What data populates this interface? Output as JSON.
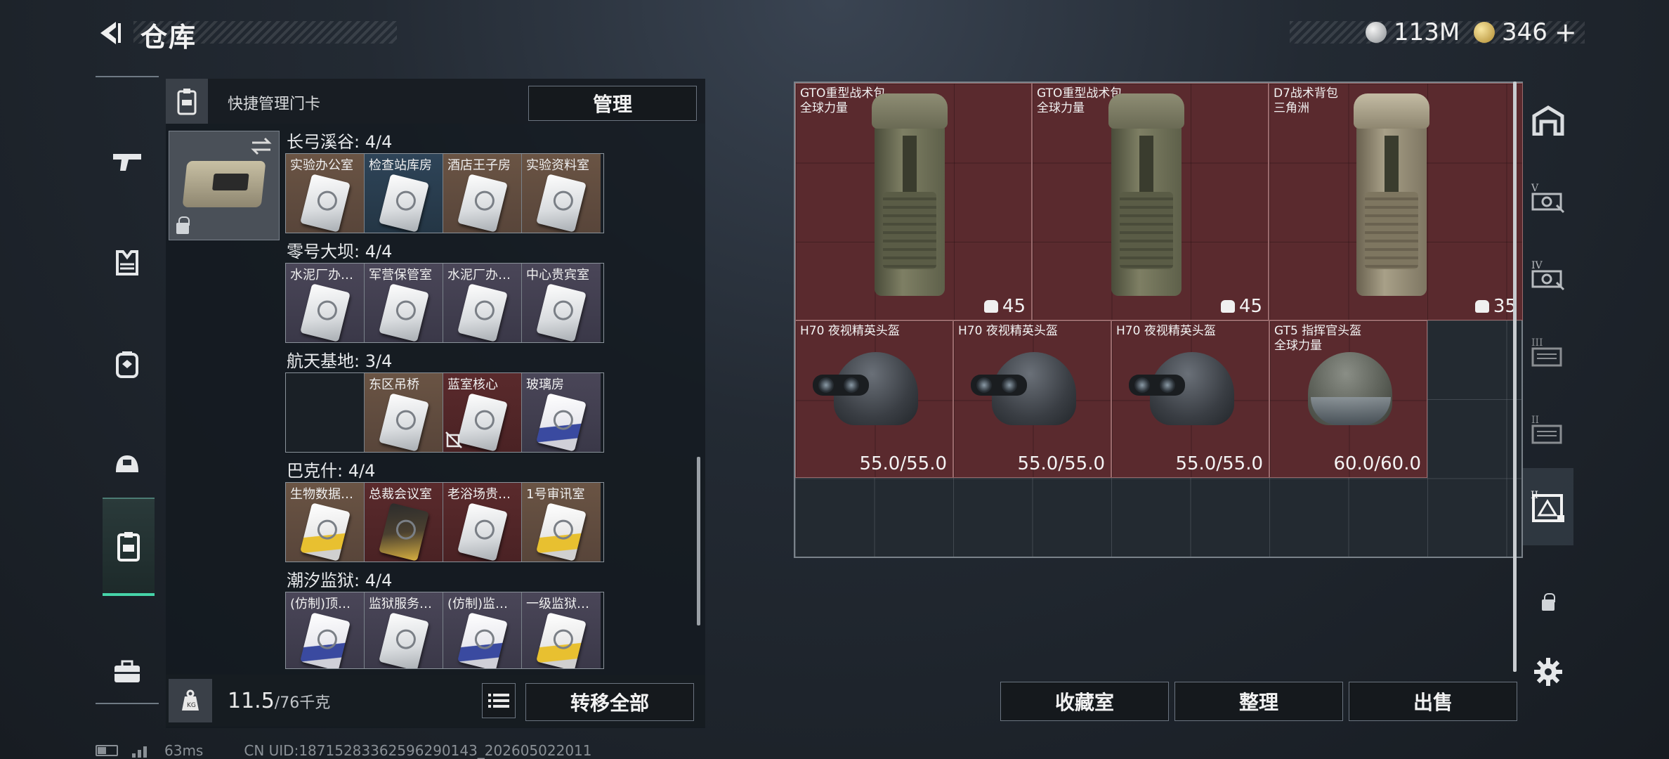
{
  "header": {
    "title": "仓库",
    "currency_silver": "113M",
    "currency_gold": "346",
    "add_label": "+"
  },
  "left_nav": [
    "weapons",
    "armor-vest",
    "backpack",
    "helmet",
    "keycard",
    "briefcase"
  ],
  "key_panel": {
    "header_label": "快捷管理门卡",
    "manage_label": "管理",
    "regions": [
      {
        "title": "长弓溪谷: 4/4",
        "cards": [
          {
            "name": "实验办公室",
            "rarity": "brown"
          },
          {
            "name": "检查站库房",
            "rarity": "blue"
          },
          {
            "name": "酒店王子房",
            "rarity": "brown"
          },
          {
            "name": "实验资料室",
            "rarity": "brown"
          }
        ]
      },
      {
        "title": "零号大坝: 4/4",
        "cards": [
          {
            "name": "水泥厂办…",
            "rarity": "purple"
          },
          {
            "name": "军营保管室",
            "rarity": "purple"
          },
          {
            "name": "水泥厂办…",
            "rarity": "purple"
          },
          {
            "name": "中心贵宾室",
            "rarity": "purple"
          }
        ]
      },
      {
        "title": "航天基地: 3/4",
        "cards": [
          {
            "name": "",
            "rarity": "empty"
          },
          {
            "name": "东区吊桥",
            "rarity": "brown"
          },
          {
            "name": "蓝室核心",
            "rarity": "red"
          },
          {
            "name": "玻璃房",
            "rarity": "purple"
          }
        ]
      },
      {
        "title": "巴克什: 4/4",
        "cards": [
          {
            "name": "生物数据…",
            "rarity": "brown"
          },
          {
            "name": "总裁会议室",
            "rarity": "red"
          },
          {
            "name": "老浴场贵…",
            "rarity": "red"
          },
          {
            "name": "1号审讯室",
            "rarity": "brown"
          }
        ]
      },
      {
        "title": "潮汐监狱: 4/4",
        "cards": [
          {
            "name": "(仿制)顶…",
            "rarity": "purple"
          },
          {
            "name": "监狱服务…",
            "rarity": "purple"
          },
          {
            "name": "(仿制)监…",
            "rarity": "purple"
          },
          {
            "name": "一级监狱…",
            "rarity": "purple"
          }
        ]
      }
    ],
    "weight_current": "11.5",
    "weight_max": "/76千克",
    "transfer_all_label": "转移全部"
  },
  "stash": {
    "items": [
      {
        "name": "GTO重型战术包",
        "subtitle": "全球力量",
        "stat": "45",
        "kind": "backpack"
      },
      {
        "name": "GTO重型战术包",
        "subtitle": "全球力量",
        "stat": "45",
        "kind": "backpack"
      },
      {
        "name": "D7战术背包",
        "subtitle": "三角洲",
        "stat": "35",
        "kind": "backpack-tan"
      },
      {
        "name": "H70 夜视精英头盔",
        "subtitle": "",
        "stat": "55.0/55.0",
        "kind": "helmet-nvg"
      },
      {
        "name": "H70 夜视精英头盔",
        "subtitle": "",
        "stat": "55.0/55.0",
        "kind": "helmet-nvg"
      },
      {
        "name": "H70 夜视精英头盔",
        "subtitle": "",
        "stat": "55.0/55.0",
        "kind": "helmet-nvg"
      },
      {
        "name": "GT5 指挥官头盔",
        "subtitle": "全球力量",
        "stat": "60.0/60.0",
        "kind": "helmet-commander"
      }
    ]
  },
  "right_nav": [
    "main-stash",
    "tier-v",
    "tier-iv",
    "tier-iii",
    "tier-ii",
    "tier-i-active",
    "locked"
  ],
  "actions": {
    "collection_label": "收藏室",
    "sort_label": "整理",
    "sell_label": "出售"
  },
  "status": {
    "ping": "63ms",
    "uid": "CN UID:18715283362596290143_202605022011"
  },
  "colors": {
    "accent_green": "#46d3a8",
    "item_red": "#5a2a2e",
    "rarity_brown": "#6a5444",
    "rarity_blue": "#2e4458",
    "rarity_purple": "#4a4658",
    "rarity_red": "#5a2a2c"
  }
}
